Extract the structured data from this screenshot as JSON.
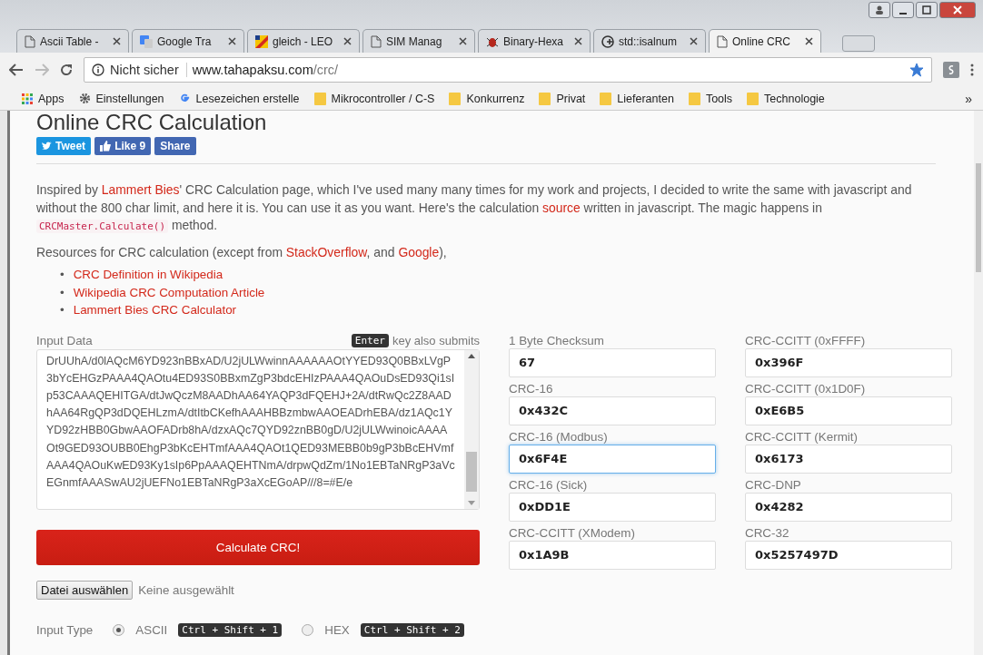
{
  "tabs": [
    {
      "label": "Ascii Table -",
      "selected": false
    },
    {
      "label": "Google Tra",
      "selected": false
    },
    {
      "label": "gleich - LEO",
      "selected": false
    },
    {
      "label": "SIM Manag",
      "selected": false
    },
    {
      "label": "Binary-Hexa",
      "selected": false
    },
    {
      "label": "std::isalnum",
      "selected": false
    },
    {
      "label": "Online CRC",
      "selected": true
    }
  ],
  "address_bar": {
    "security": "Nicht sicher",
    "host": "www.tahapaksu.com",
    "path": "/crc/",
    "bookmarked": true
  },
  "bookmarks": [
    "Apps",
    "Einstellungen",
    "Lesezeichen erstelle",
    "Mikrocontroller / C-S",
    "Konkurrenz",
    "Privat",
    "Lieferanten",
    "Tools",
    "Technologie"
  ],
  "bookmarks_more": "»",
  "page": {
    "title": "Online CRC Calculation",
    "social": [
      {
        "kind": "tweet",
        "label": "Tweet"
      },
      {
        "kind": "like",
        "label": "Like 9"
      },
      {
        "kind": "share",
        "label": "Share"
      }
    ],
    "intro": [
      {
        "kind": "text",
        "text": "Inspired by "
      },
      {
        "kind": "link",
        "text": "Lammert Bies"
      },
      {
        "kind": "text",
        "text": "' CRC Calculation page, which I've used many many times for my work and projects, I decided to write the same with javascript and without the 800 char limit, and here it is. You can use it as you want. Here's the calculation "
      },
      {
        "kind": "link",
        "text": "source"
      },
      {
        "kind": "text",
        "text": " written in javascript. The magic happens in "
      },
      {
        "kind": "code",
        "text": "CRCMaster.Calculate()"
      },
      {
        "kind": "text",
        "text": " method."
      }
    ],
    "resources": [
      {
        "kind": "text",
        "text": "Resources for CRC calculation (except from "
      },
      {
        "kind": "link",
        "text": "StackOverflow"
      },
      {
        "kind": "text",
        "text": ", and "
      },
      {
        "kind": "link",
        "text": "Google"
      },
      {
        "kind": "text",
        "text": "),"
      }
    ],
    "resource_bullet": "•",
    "resource_links": [
      "CRC Definition in Wikipedia",
      "Wikipedia CRC Computation Article",
      "Lammert Bies CRC Calculator"
    ],
    "input_label": "Input Data",
    "enter_key": "Enter",
    "enter_hint": "key also submits",
    "input_value": "DrUUhA/d0lAQcM6YD923nBBxAD/U2jULWwinnAAAAAAOtYYED93Q0BBxLVgP3bYcEHGzPAAA4QAOtu4ED93S0BBxmZgP3bdcEHIzPAAA4QAOuDsED93Qi1sIp53CAAAQEHITGA/dtJwQczM8AADhAA64YAQP3dFQEHJ+2A/dtRwQc2Z8AADhAA64RgQP3dDQEHLzmA/dtItbCKefhAAAHBBzmbwAAOEADrhEBA/dz1AQc1YYD92zHBB0GbwAAOFADrb8hA/dzxAQc7QYD92znBB0gD/U2jULWwinoicAAAAOt9GED93OUBB0EhgP3bKcEHTmfAAA4QAOt1QED93MEBB0b9gP3bBcEHVmfAAA4QAOuKwED93Ky1sIp6PpAAAQEHTNmA/drpwQdZm/1No1EBTaNRgP3aVcEGnmfAAASwAU2jUEFNo1EBTaNRgP3aXcEGoAP///8=#E/e",
    "calculate_button": "Calculate CRC!",
    "file_button": "Datei auswählen",
    "file_status": "Keine ausgewählt",
    "input_type_label": "Input Type",
    "input_types": [
      {
        "label": "ASCII",
        "shortcut": "Ctrl + Shift + 1",
        "selected": true
      },
      {
        "label": "HEX",
        "shortcut": "Ctrl + Shift + 2",
        "selected": false
      }
    ],
    "results": [
      {
        "label": "1 Byte Checksum",
        "value": "67",
        "focused": false
      },
      {
        "label": "CRC-CCITT (0xFFFF)",
        "value": "0x396F",
        "focused": false
      },
      {
        "label": "CRC-16",
        "value": "0x432C",
        "focused": false
      },
      {
        "label": "CRC-CCITT (0x1D0F)",
        "value": "0xE6B5",
        "focused": false
      },
      {
        "label": "CRC-16 (Modbus)",
        "value": "0x6F4E",
        "focused": true
      },
      {
        "label": "CRC-CCITT (Kermit)",
        "value": "0x6173",
        "focused": false
      },
      {
        "label": "CRC-16 (Sick)",
        "value": "0xDD1E",
        "focused": false
      },
      {
        "label": "CRC-DNP",
        "value": "0x4282",
        "focused": false
      },
      {
        "label": "CRC-CCITT (XModem)",
        "value": "0x1A9B",
        "focused": false
      },
      {
        "label": "CRC-32",
        "value": "0x5257497D",
        "focused": false
      }
    ]
  }
}
